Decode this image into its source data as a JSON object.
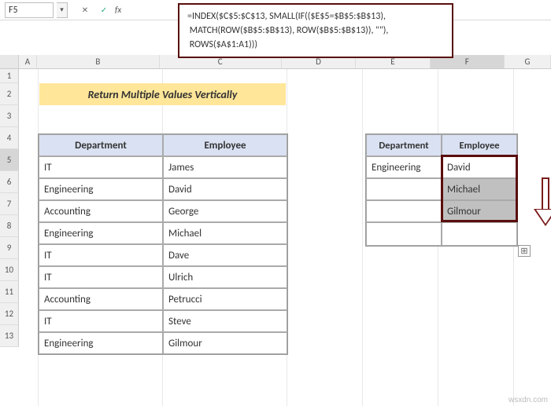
{
  "nameBox": "F5",
  "fxLabel": "fx",
  "formula": {
    "line1": "=INDEX($C$5:$C$13, SMALL(IF(($E$5=$B$5:$B$13),",
    "line2": " MATCH(ROW($B$5:$B$13), ROW($B$5:$B$13)), \"\"),",
    "line3": " ROWS($A$1:A1)))"
  },
  "title": "Return Multiple Values Vertically",
  "columns": {
    "A": "A",
    "B": "B",
    "C": "C",
    "D": "D",
    "E": "E",
    "F": "F",
    "G": "G"
  },
  "rows": [
    "1",
    "2",
    "3",
    "4",
    "5",
    "6",
    "7",
    "8",
    "9",
    "10",
    "11",
    "12",
    "13"
  ],
  "mainTable": {
    "headers": {
      "dept": "Department",
      "emp": "Employee"
    },
    "rows": [
      {
        "dept": "IT",
        "emp": "James"
      },
      {
        "dept": "Engineering",
        "emp": "David"
      },
      {
        "dept": "Accounting",
        "emp": "George"
      },
      {
        "dept": "Engineering",
        "emp": "Michael"
      },
      {
        "dept": "IT",
        "emp": "Dave"
      },
      {
        "dept": "IT",
        "emp": "Ulrich"
      },
      {
        "dept": "Accounting",
        "emp": "Petrucci"
      },
      {
        "dept": "IT",
        "emp": "Steve"
      },
      {
        "dept": "Engineering",
        "emp": "Gilmour"
      }
    ]
  },
  "rightTable": {
    "headers": {
      "dept": "Department",
      "emp": "Employee"
    },
    "rows": [
      {
        "dept": "Engineering",
        "emp": "David"
      },
      {
        "dept": "",
        "emp": "Michael"
      },
      {
        "dept": "",
        "emp": "Gilmour"
      },
      {
        "dept": "",
        "emp": ""
      }
    ]
  },
  "watermark": "wsxdn.com"
}
